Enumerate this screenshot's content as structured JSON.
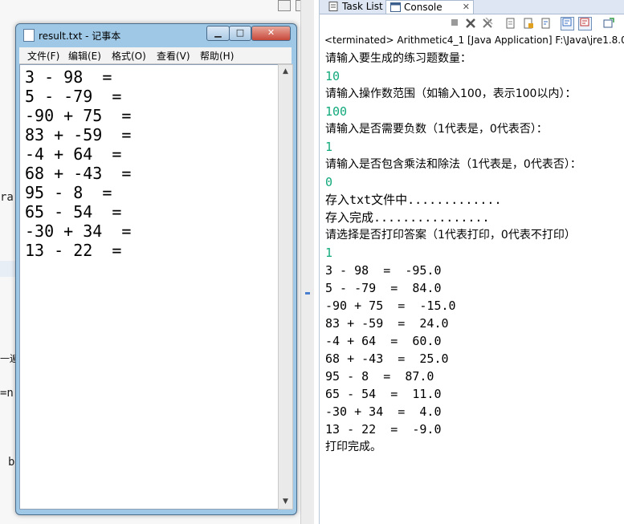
{
  "background_editor": {
    "fragments": [
      "ra",
      "一遍",
      "=n",
      "b"
    ]
  },
  "console": {
    "tabs": [
      {
        "label": "Task List",
        "icon": "task-list-icon"
      },
      {
        "label": "Console",
        "icon": "console-icon"
      }
    ],
    "close_glyph": "✕",
    "toolbar_icons": [
      "terminate-icon",
      "remove-launch-icon",
      "remove-all-icon",
      "clear-console-icon",
      "scroll-lock-icon",
      "word-wrap-icon",
      "show-on-stdout-icon",
      "show-on-stderr-icon",
      "open-console-icon"
    ],
    "status": "<terminated> Arithmetic4_1 [Java Application] F:\\Java\\jre1.8.0_17",
    "lines": [
      {
        "text": "请输入要生成的练习题数量：",
        "kind": "prompt"
      },
      {
        "text": "10",
        "kind": "input"
      },
      {
        "text": "请输入操作数范围（如输入100，表示100以内）：",
        "kind": "prompt"
      },
      {
        "text": "100",
        "kind": "input"
      },
      {
        "text": "请输入是否需要负数（1代表是，0代表否）：",
        "kind": "prompt"
      },
      {
        "text": "1",
        "kind": "input"
      },
      {
        "text": "请输入是否包含乘法和除法（1代表是，0代表否）：",
        "kind": "prompt"
      },
      {
        "text": "0",
        "kind": "input"
      },
      {
        "text": "存入txt文件中.............",
        "kind": "output"
      },
      {
        "text": "存入完成................",
        "kind": "output"
      },
      {
        "text": "请选择是否打印答案（1代表打印，0代表不打印）",
        "kind": "prompt"
      },
      {
        "text": "1",
        "kind": "input"
      },
      {
        "text": "3 - 98  =  -95.0",
        "kind": "output"
      },
      {
        "text": "5 - -79  =  84.0",
        "kind": "output"
      },
      {
        "text": "-90 + 75  =  -15.0",
        "kind": "output"
      },
      {
        "text": "83 + -59  =  24.0",
        "kind": "output"
      },
      {
        "text": "-4 + 64  =  60.0",
        "kind": "output"
      },
      {
        "text": "68 + -43  =  25.0",
        "kind": "output"
      },
      {
        "text": "95 - 8  =  87.0",
        "kind": "output"
      },
      {
        "text": "65 - 54  =  11.0",
        "kind": "output"
      },
      {
        "text": "-30 + 34  =  4.0",
        "kind": "output"
      },
      {
        "text": "13 - 22  =  -9.0",
        "kind": "output"
      },
      {
        "text": "打印完成。",
        "kind": "prompt"
      }
    ],
    "colors": {
      "input": "#11a97c",
      "output": "#000000"
    }
  },
  "notepad": {
    "title": "result.txt - 记事本",
    "controls": {
      "minimize": "▁",
      "maximize": "□",
      "close": "✕"
    },
    "menus": [
      "文件(F)",
      "编辑(E)",
      "格式(O)",
      "查看(V)",
      "帮助(H)"
    ],
    "lines": [
      "3 - 98  =",
      "5 - -79  =",
      "-90 + 75  =",
      "83 + -59  =",
      "-4 + 64  =",
      "68 + -43  =",
      "95 - 8  =",
      "65 - 54  =",
      "-30 + 34  =",
      "13 - 22  ="
    ],
    "scroll_up": "▲",
    "scroll_down": "▼"
  }
}
